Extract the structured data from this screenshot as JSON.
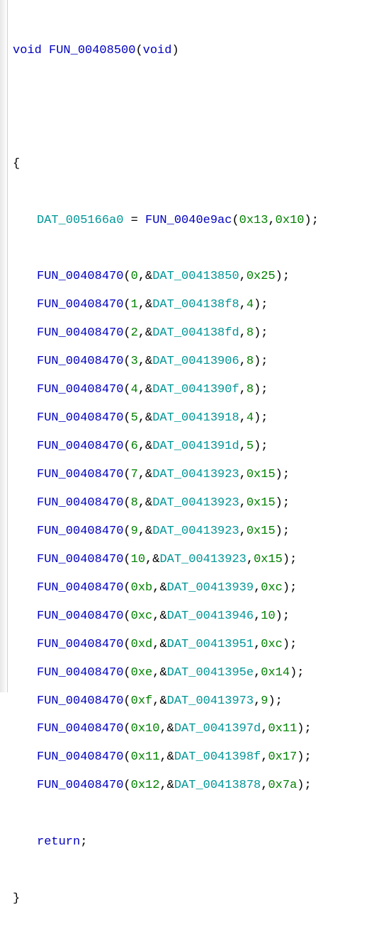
{
  "signature": {
    "ret": "void",
    "name": "FUN_00408500",
    "params": "void"
  },
  "assign": {
    "lhs": "DAT_005166a0",
    "eq": " = ",
    "rfn": "FUN_0040e9ac",
    "a1": "0x13",
    "a2": "0x10"
  },
  "calls": [
    {
      "fn": "FUN_00408470",
      "a1": "0",
      "dat": "DAT_00413850",
      "a3": "0x25"
    },
    {
      "fn": "FUN_00408470",
      "a1": "1",
      "dat": "DAT_004138f8",
      "a3": "4"
    },
    {
      "fn": "FUN_00408470",
      "a1": "2",
      "dat": "DAT_004138fd",
      "a3": "8"
    },
    {
      "fn": "FUN_00408470",
      "a1": "3",
      "dat": "DAT_00413906",
      "a3": "8"
    },
    {
      "fn": "FUN_00408470",
      "a1": "4",
      "dat": "DAT_0041390f",
      "a3": "8"
    },
    {
      "fn": "FUN_00408470",
      "a1": "5",
      "dat": "DAT_00413918",
      "a3": "4"
    },
    {
      "fn": "FUN_00408470",
      "a1": "6",
      "dat": "DAT_0041391d",
      "a3": "5"
    },
    {
      "fn": "FUN_00408470",
      "a1": "7",
      "dat": "DAT_00413923",
      "a3": "0x15"
    },
    {
      "fn": "FUN_00408470",
      "a1": "8",
      "dat": "DAT_00413923",
      "a3": "0x15"
    },
    {
      "fn": "FUN_00408470",
      "a1": "9",
      "dat": "DAT_00413923",
      "a3": "0x15"
    },
    {
      "fn": "FUN_00408470",
      "a1": "10",
      "dat": "DAT_00413923",
      "a3": "0x15"
    },
    {
      "fn": "FUN_00408470",
      "a1": "0xb",
      "dat": "DAT_00413939",
      "a3": "0xc"
    },
    {
      "fn": "FUN_00408470",
      "a1": "0xc",
      "dat": "DAT_00413946",
      "a3": "10"
    },
    {
      "fn": "FUN_00408470",
      "a1": "0xd",
      "dat": "DAT_00413951",
      "a3": "0xc"
    },
    {
      "fn": "FUN_00408470",
      "a1": "0xe",
      "dat": "DAT_0041395e",
      "a3": "0x14"
    },
    {
      "fn": "FUN_00408470",
      "a1": "0xf",
      "dat": "DAT_00413973",
      "a3": "9"
    },
    {
      "fn": "FUN_00408470",
      "a1": "0x10",
      "dat": "DAT_0041397d",
      "a3": "0x11"
    },
    {
      "fn": "FUN_00408470",
      "a1": "0x11",
      "dat": "DAT_0041398f",
      "a3": "0x17"
    },
    {
      "fn": "FUN_00408470",
      "a1": "0x12",
      "dat": "DAT_00413878",
      "a3": "0x7a"
    }
  ],
  "ret": "return",
  "braces": {
    "open": "{",
    "close": "}"
  },
  "tokens": {
    "lp": "(",
    "rp": ")",
    "comma": ",",
    "amp": "&",
    "semi": ";",
    "sp": " "
  }
}
